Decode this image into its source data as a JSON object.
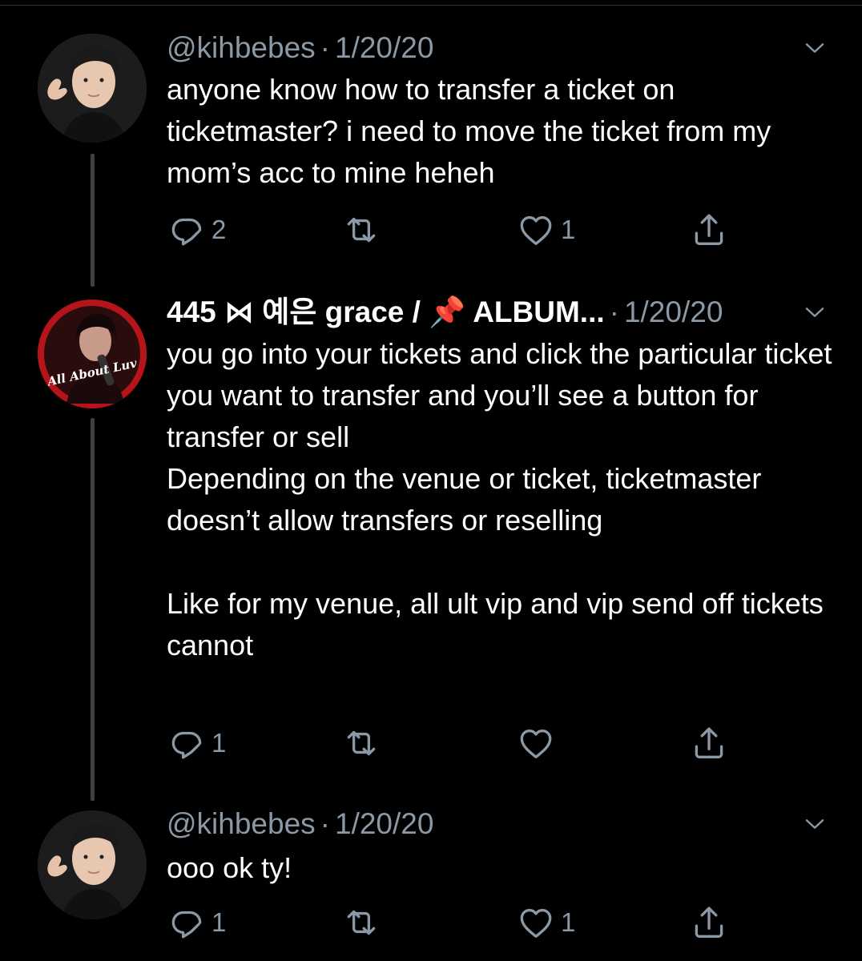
{
  "tweets": [
    {
      "handle": "@kihbebes",
      "display_name": "",
      "date": "1/20/20",
      "text": "anyone know how to transfer a ticket on ticketmaster? i need to move the ticket from my mom’s acc to mine heheh",
      "replies": "2",
      "retweets": "",
      "likes": "1"
    },
    {
      "display_name": "445 ⋈ 예은 grace / 📌 ALBUM...",
      "date": "1/20/20",
      "avatar_text": "All About Luv",
      "text": "you go into your tickets and click the particular ticket you want to transfer and you’ll see a button for transfer or sell\nDepending on the venue or ticket, ticketmaster doesn’t allow transfers or reselling\n\nLike for my venue, all ult vip and vip send off tickets cannot",
      "replies": "1",
      "retweets": "",
      "likes": ""
    },
    {
      "handle": "@kihbebes",
      "date": "1/20/20",
      "text": "ooo ok ty!",
      "replies": "1",
      "retweets": "",
      "likes": "1"
    }
  ],
  "separator": "·",
  "icons": {
    "menu": "chevron-down-icon",
    "reply": "reply-icon",
    "retweet": "retweet-icon",
    "like": "heart-icon",
    "share": "share-icon"
  },
  "colors": {
    "background": "#000000",
    "text": "#ffffff",
    "secondary": "#8b98a5",
    "thread_line": "#3d4145"
  }
}
